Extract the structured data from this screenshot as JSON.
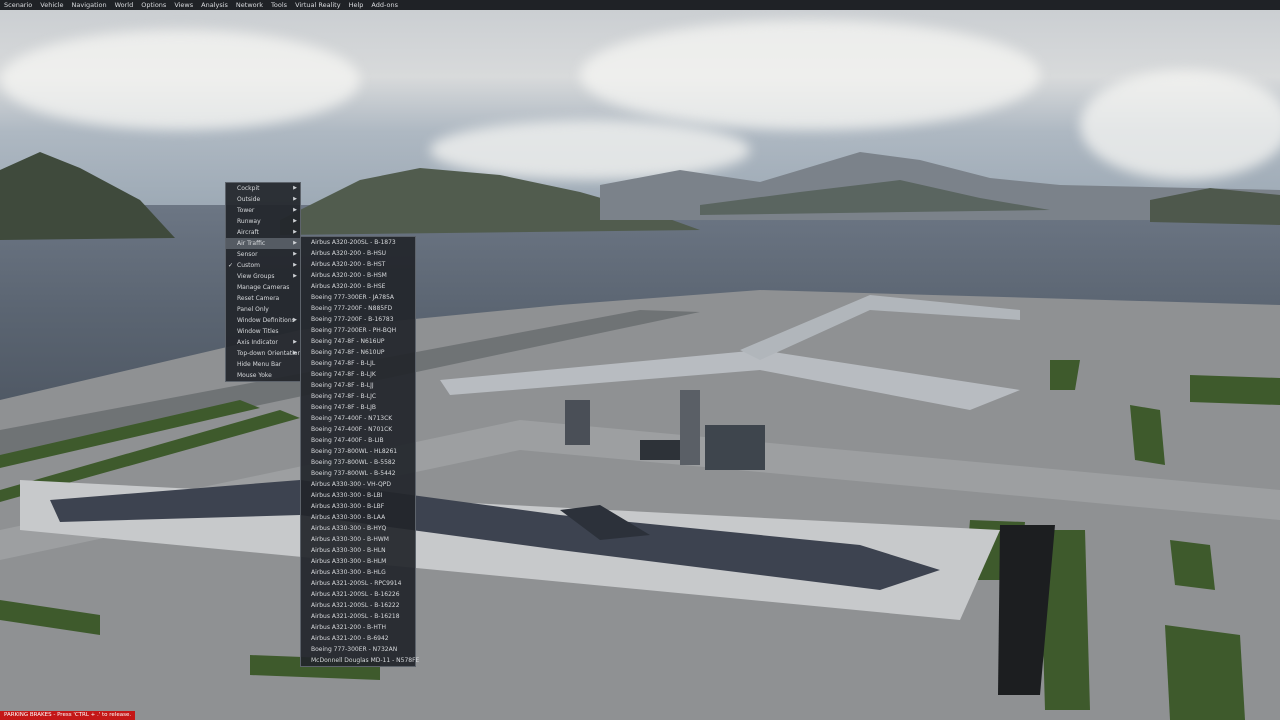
{
  "menubar": {
    "items": [
      "Scenario",
      "Vehicle",
      "Navigation",
      "World",
      "Options",
      "Views",
      "Analysis",
      "Network",
      "Tools",
      "Virtual Reality",
      "Help",
      "Add-ons"
    ]
  },
  "views_menu": {
    "items": [
      {
        "label": "Cockpit",
        "submenu": true
      },
      {
        "label": "Outside",
        "submenu": true
      },
      {
        "label": "Tower",
        "submenu": true
      },
      {
        "label": "Runway",
        "submenu": true
      },
      {
        "label": "Aircraft",
        "submenu": true
      },
      {
        "label": "Air Traffic",
        "submenu": true,
        "active": true
      },
      {
        "label": "Sensor",
        "submenu": true
      },
      {
        "label": "Custom",
        "submenu": true,
        "checked": true
      },
      {
        "label": "View Groups",
        "submenu": true
      },
      {
        "label": "Manage Cameras",
        "submenu": false
      },
      {
        "label": "Reset Camera",
        "submenu": false
      },
      {
        "label": "Panel Only",
        "submenu": false
      },
      {
        "label": "Window Definitions",
        "submenu": true
      },
      {
        "label": "Window Titles",
        "submenu": false
      },
      {
        "label": "Axis Indicator",
        "submenu": true
      },
      {
        "label": "Top-down Orientation",
        "submenu": true
      },
      {
        "label": "Hide Menu Bar",
        "submenu": false
      },
      {
        "label": "Mouse Yoke",
        "submenu": false
      }
    ]
  },
  "air_traffic_menu": {
    "items": [
      "Airbus A320-200SL - B-1873",
      "Airbus A320-200 - B-HSU",
      "Airbus A320-200 - B-HST",
      "Airbus A320-200 - B-HSM",
      "Airbus A320-200 - B-HSE",
      "Boeing 777-300ER - JA785A",
      "Boeing 777-200F - N885FD",
      "Boeing 777-200F - B-16783",
      "Boeing 777-200ER - PH-BQH",
      "Boeing 747-8F - N616UP",
      "Boeing 747-8F - N610UP",
      "Boeing 747-8F - B-LJL",
      "Boeing 747-8F - B-LJK",
      "Boeing 747-8F - B-LJJ",
      "Boeing 747-8F - B-LJC",
      "Boeing 747-8F - B-LJB",
      "Boeing 747-400F - N713CK",
      "Boeing 747-400F - N701CK",
      "Boeing 747-400F - B-LIB",
      "Boeing 737-800WL - HL8261",
      "Boeing 737-800WL - B-5582",
      "Boeing 737-800WL - B-5442",
      "Airbus A330-300 - VH-QPD",
      "Airbus A330-300 - B-LBI",
      "Airbus A330-300 - B-LBF",
      "Airbus A330-300 - B-LAA",
      "Airbus A330-300 - B-HYQ",
      "Airbus A330-300 - B-HWM",
      "Airbus A330-300 - B-HLN",
      "Airbus A330-300 - B-HLM",
      "Airbus A330-300 - B-HLG",
      "Airbus A321-200SL - RPC9914",
      "Airbus A321-200SL - B-16226",
      "Airbus A321-200SL - B-16222",
      "Airbus A321-200SL - B-16218",
      "Airbus A321-200 - B-HTH",
      "Airbus A321-200 - B-6942",
      "Boeing 777-300ER - N732AN",
      "McDonnell Douglas MD-11 - N578FE"
    ]
  },
  "status": {
    "parking_brake": "PARKING BRAKES - Press 'CTRL + .' to release."
  }
}
